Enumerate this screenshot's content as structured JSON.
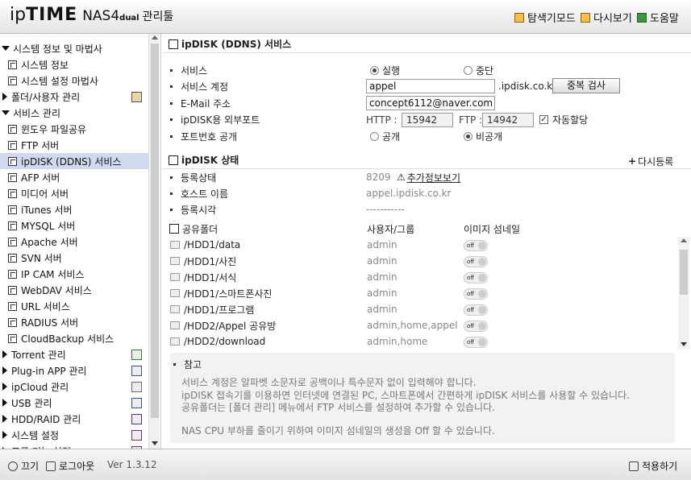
{
  "header": {
    "logo_ip": "ip",
    "logo_time": "TIME",
    "model": "NAS4",
    "dual": "dual",
    "admin": "관리툴",
    "explorer": "탐색기모드",
    "reload": "다시보기",
    "help": "도움말"
  },
  "sidebar": {
    "items": [
      {
        "label": "시스템 정보 및 마법사",
        "level": 0
      },
      {
        "label": "시스템 정보",
        "level": 1
      },
      {
        "label": "시스템 설정 마법사",
        "level": 1
      },
      {
        "label": "폴더/사용자 관리",
        "level": 0
      },
      {
        "label": "서비스 관리",
        "level": 0
      },
      {
        "label": "윈도우 파일공유",
        "level": 1
      },
      {
        "label": "FTP 서버",
        "level": 1
      },
      {
        "label": "ipDISK (DDNS) 서비스",
        "level": 1
      },
      {
        "label": "AFP 서버",
        "level": 1
      },
      {
        "label": "미디어 서버",
        "level": 1
      },
      {
        "label": "iTunes 서버",
        "level": 1
      },
      {
        "label": "MYSQL 서버",
        "level": 1
      },
      {
        "label": "Apache 서버",
        "level": 1
      },
      {
        "label": "SVN 서버",
        "level": 1
      },
      {
        "label": "IP CAM 서비스",
        "level": 1
      },
      {
        "label": "WebDAV 서비스",
        "level": 1
      },
      {
        "label": "URL 서비스",
        "level": 1
      },
      {
        "label": "RADIUS 서버",
        "level": 1
      },
      {
        "label": "CloudBackup 서비스",
        "level": 1
      },
      {
        "label": "Torrent 관리",
        "level": 0
      },
      {
        "label": "Plug-in APP 관리",
        "level": 0
      },
      {
        "label": "ipCloud 관리",
        "level": 0
      },
      {
        "label": "USB 관리",
        "level": 0
      },
      {
        "label": "HDD/RAID 관리",
        "level": 0
      },
      {
        "label": "시스템 설정",
        "level": 0
      },
      {
        "label": "고급 기능 설정",
        "level": 0
      }
    ]
  },
  "footer": {
    "power": "끄기",
    "logout": "로그아웃",
    "version": "Ver 1.3.12",
    "apply": "적용하기"
  },
  "ddns": {
    "title": "ipDISK (DDNS) 서비스",
    "service_label": "서비스",
    "run": "실행",
    "stop": "중단",
    "account_label": "서비스 계정",
    "account_value": "appel",
    "domain_suffix": ".ipdisk.co.kr",
    "dup_check": "중복 검사",
    "email_label": "E-Mail 주소",
    "email_value": "concept6112@naver.com",
    "port_label": "ipDISK용 외부포트",
    "http_label": "HTTP :",
    "http_value": "15942",
    "ftp_label": "FTP :",
    "ftp_value": "14942",
    "auto_assign": "자동할당",
    "port_public_label": "포트번호 공개",
    "public": "공개",
    "private": "비공개"
  },
  "status": {
    "title": "ipDISK 상태",
    "reregister": "다시등록",
    "reg_label": "등록상태",
    "reg_code": "8209",
    "more_info": "추가정보보기",
    "host_label": "호스트 이름",
    "host_value": "appel.ipdisk.co.kr",
    "time_label": "등록시각",
    "time_value": "-----------"
  },
  "share": {
    "col_folder": "공유폴더",
    "col_user": "사용자/그룹",
    "col_thumb": "이미지 섬네일",
    "toggle_label": "off",
    "rows": [
      {
        "folder": "/HDD1/data",
        "user": "admin"
      },
      {
        "folder": "/HDD1/사진",
        "user": "admin"
      },
      {
        "folder": "/HDD1/서식",
        "user": "admin"
      },
      {
        "folder": "/HDD1/스마트폰사진",
        "user": "admin"
      },
      {
        "folder": "/HDD1/프로그램",
        "user": "admin"
      },
      {
        "folder": "/HDD2/Appel 공유방",
        "user": "admin,home,appel"
      },
      {
        "folder": "/HDD2/download",
        "user": "admin,home"
      }
    ]
  },
  "note": {
    "title": "참고",
    "lines": [
      "서비스 계정은 알파벳 소문자로 공백이나 특수문자 없이 입력해야 합니다.",
      "ipDISK 접속기를 이용하면 인터넷에 연결된 PC, 스마트폰에서 간편하게 ipDISK 서비스를 사용할 수 있습니다.",
      "공유폴더는 [폴더 관리] 메뉴에서 FTP 서비스를 설정하여 추가할 수 있습니다.",
      "NAS CPU 부하를 줄이기 위하여 이미지 섬네일의 생성을 Off 할 수 있습니다."
    ]
  }
}
